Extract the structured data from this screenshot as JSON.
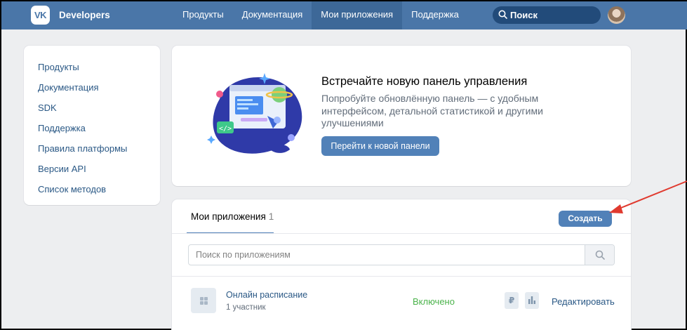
{
  "header": {
    "logo": "VK",
    "brand": "Developers",
    "nav": [
      {
        "label": "Продукты"
      },
      {
        "label": "Документация"
      },
      {
        "label": "Мои приложения",
        "active": true
      },
      {
        "label": "Поддержка"
      }
    ],
    "search_label": "Поиск",
    "color": "#4a76a8"
  },
  "sidebar": {
    "items": [
      {
        "label": "Продукты"
      },
      {
        "label": "Документация"
      },
      {
        "label": "SDK"
      },
      {
        "label": "Поддержка"
      },
      {
        "label": "Правила платформы"
      },
      {
        "label": "Версии API"
      },
      {
        "label": "Список методов"
      }
    ]
  },
  "promo": {
    "title": "Встречайте новую панель управления",
    "text": "Попробуйте обновлённую панель — с удобным интерфейсом, детальной статистикой и другими улучшениями",
    "button": "Перейти к новой панели",
    "code_tag": "</>"
  },
  "apps": {
    "tab_label": "Мои приложения",
    "tab_count": "1",
    "create_button": "Создать",
    "search_placeholder": "Поиск по приложениям",
    "list": [
      {
        "name": "Онлайн расписание",
        "members": "1 участник",
        "status": "Включено",
        "payments_icon": "₽",
        "edit": "Редактировать"
      }
    ],
    "status_color": "#4bb34b"
  },
  "annotation": {
    "arrow_color": "#e03a2f"
  }
}
